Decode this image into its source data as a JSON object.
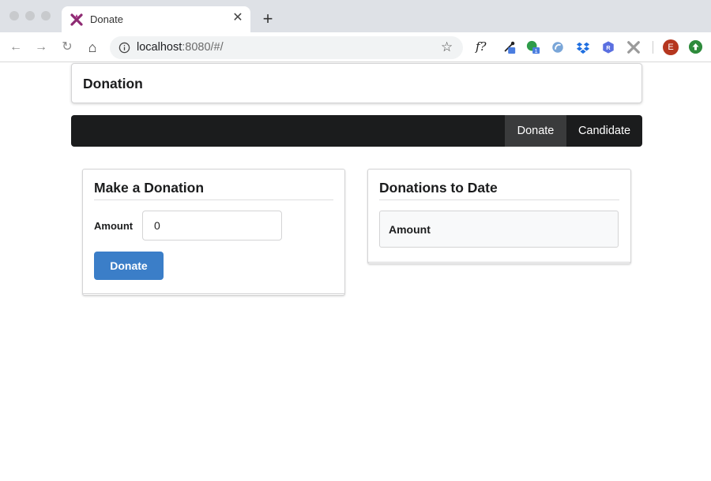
{
  "browser": {
    "tab": {
      "title": "Donate",
      "close_glyph": "✕",
      "favicon": "crossed-arrows-icon",
      "favicon_color": "#8e2a73"
    },
    "new_tab_glyph": "+",
    "nav": {
      "back": "←",
      "forward": "→",
      "reload": "↻",
      "home": "⌂"
    },
    "address": {
      "host": "localhost",
      "rest": ":8080/#/",
      "star": "☆"
    },
    "extensions": {
      "fx_label": "f?",
      "badge_count": "1"
    },
    "profile_initial": "E"
  },
  "page": {
    "header_title": "Donation",
    "menu": [
      {
        "label": "Donate",
        "active": true
      },
      {
        "label": "Candidate",
        "active": false
      }
    ],
    "donation_form": {
      "title": "Make a Donation",
      "amount_label": "Amount",
      "amount_value": "0",
      "button_label": "Donate"
    },
    "donations_to_date": {
      "title": "Donations to Date",
      "column_header": "Amount"
    }
  },
  "colors": {
    "menu_bg": "#1b1c1d",
    "menu_active_bg": "#3a3b3c",
    "primary_button": "#3b7ec8"
  }
}
